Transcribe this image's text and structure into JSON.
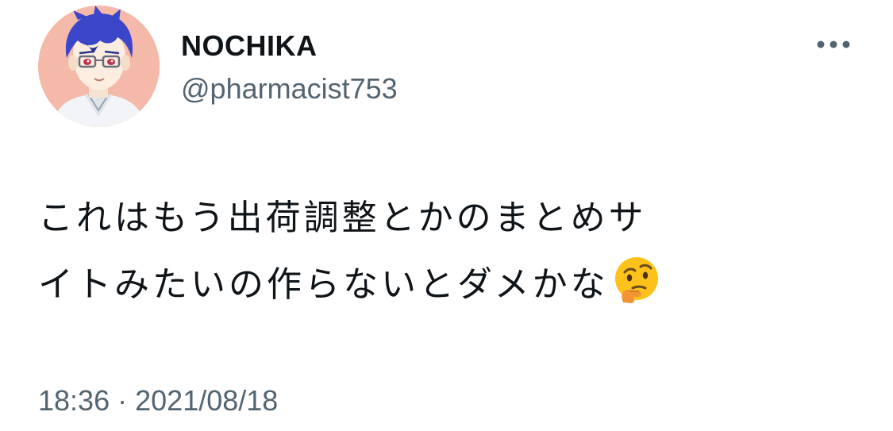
{
  "tweet": {
    "author": {
      "display_name": "NOCHIKA",
      "handle": "@pharmacist753",
      "avatar_icon": "anime-avatar-pharmacist"
    },
    "text_line1": "これはもう出荷調整とかのまとめサ",
    "text_line2": "イトみたいの作らないとダメかな",
    "emoji": "thinking-face-emoji",
    "time": "18:36",
    "separator": "·",
    "date": "2021/08/18",
    "more_icon": "more-horizontal-icon"
  }
}
